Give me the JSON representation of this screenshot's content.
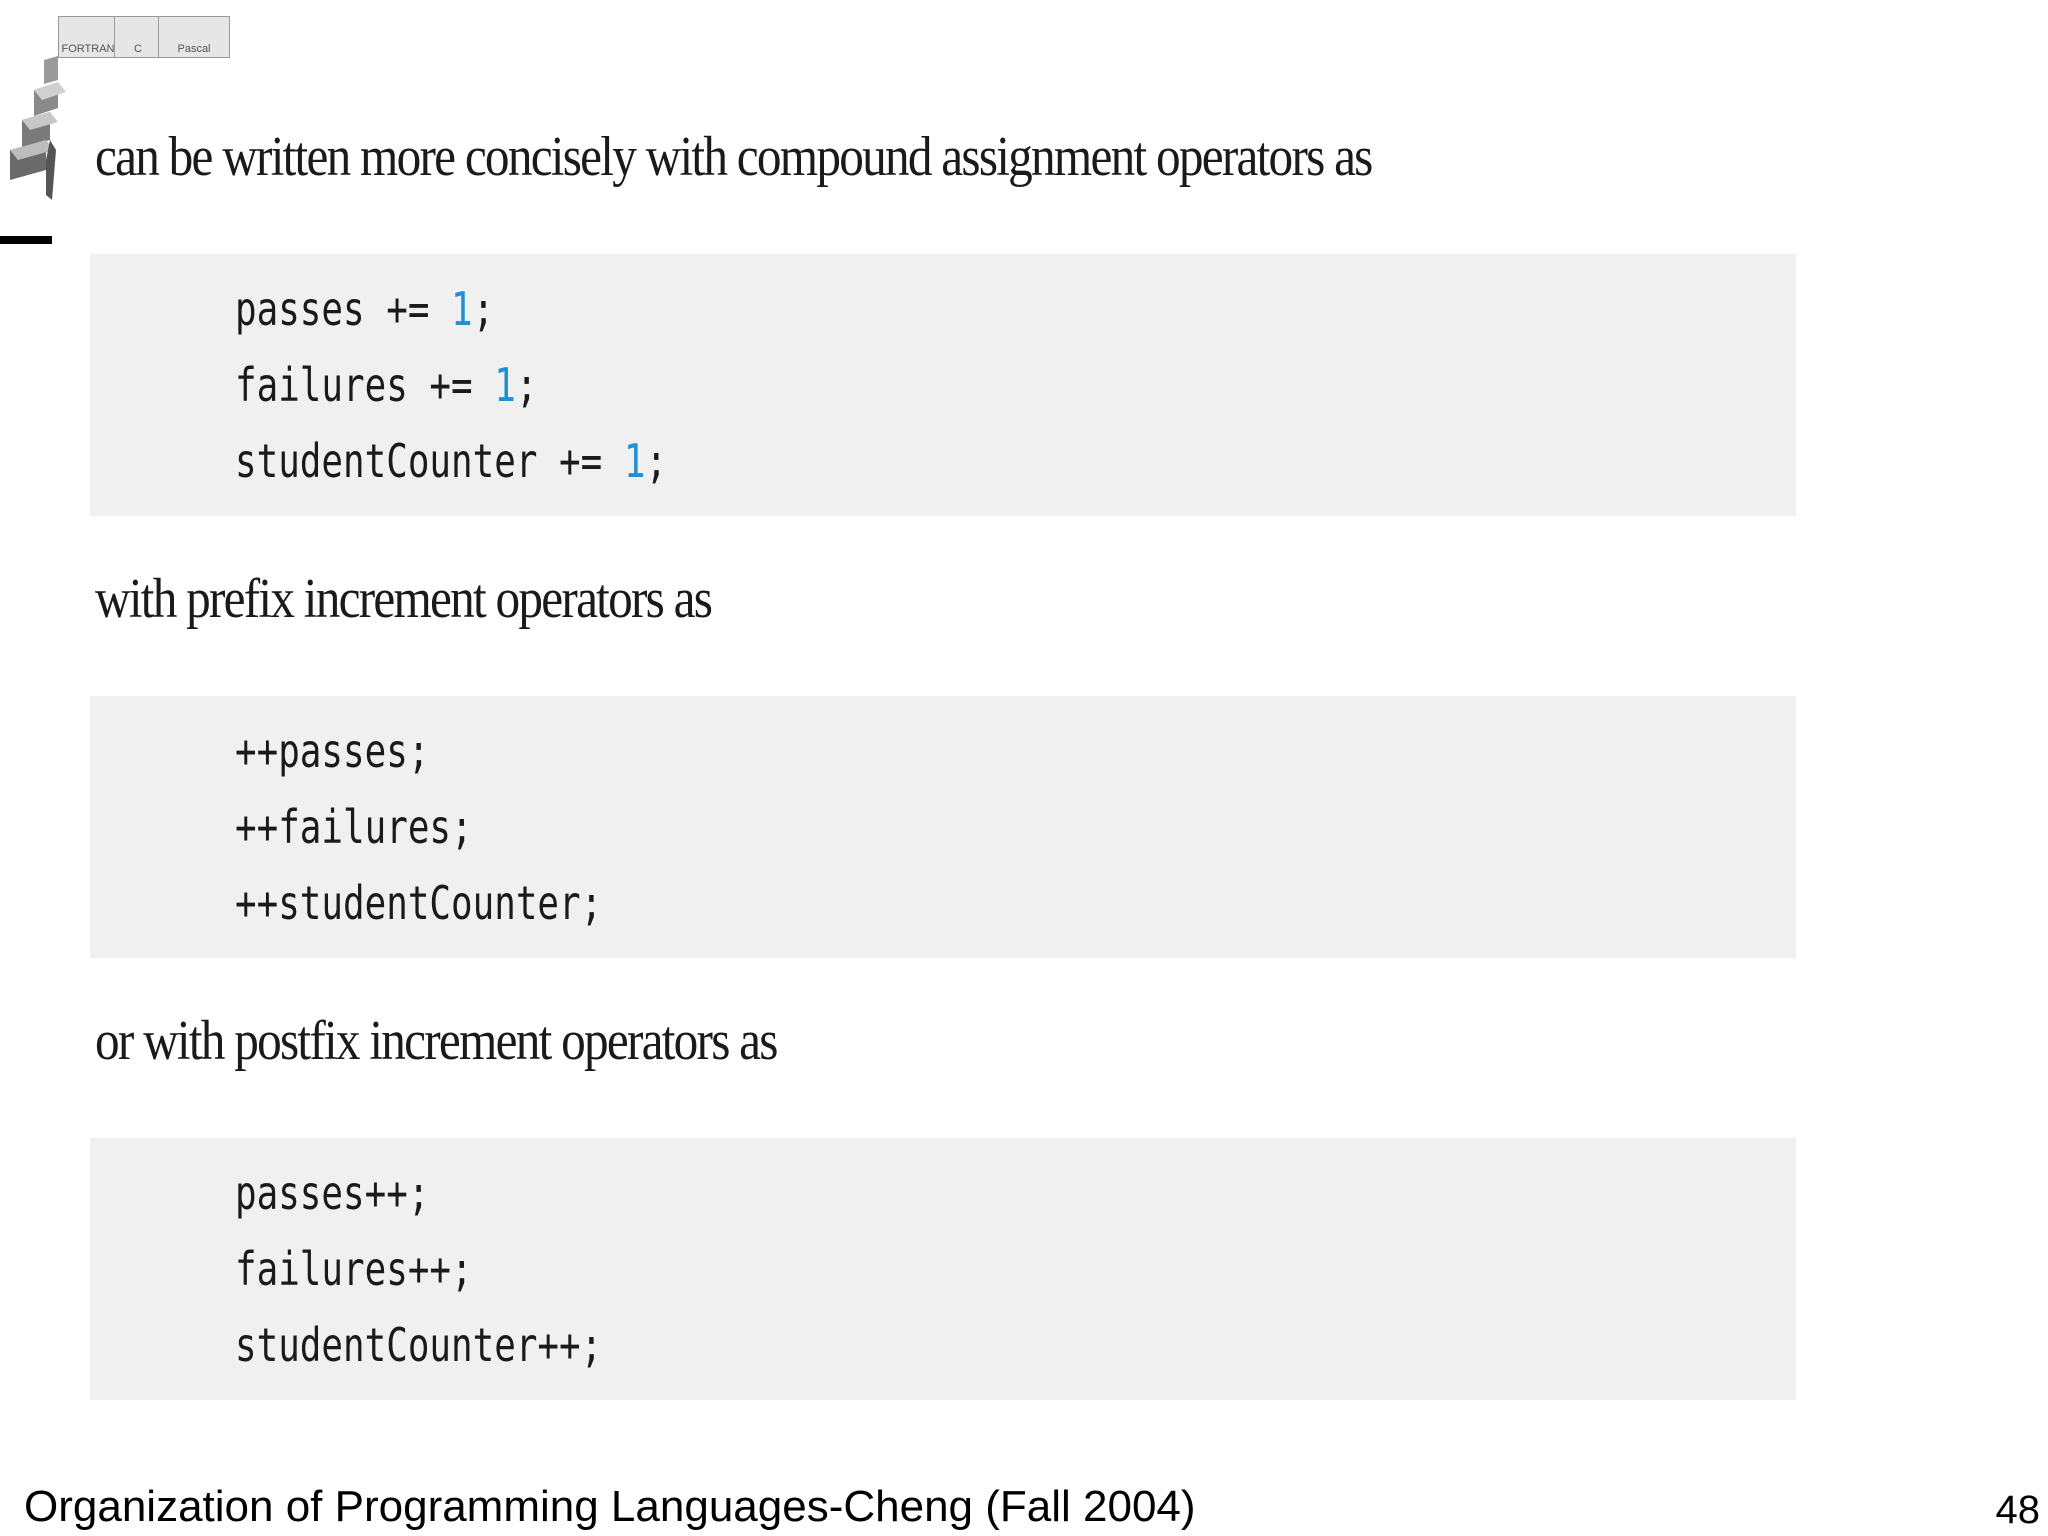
{
  "logo": {
    "tabs": [
      "FORTRAN",
      "C",
      "Pascal"
    ]
  },
  "sections": [
    {
      "intro": "can be written more concisely with compound assignment operators as",
      "lines": [
        {
          "pre": "passes += ",
          "num": "1",
          "post": ";"
        },
        {
          "pre": "failures += ",
          "num": "1",
          "post": ";"
        },
        {
          "pre": "studentCounter += ",
          "num": "1",
          "post": ";"
        }
      ]
    },
    {
      "intro": "with prefix increment operators as",
      "lines": [
        {
          "pre": "++passes;",
          "num": "",
          "post": ""
        },
        {
          "pre": "++failures;",
          "num": "",
          "post": ""
        },
        {
          "pre": "++studentCounter;",
          "num": "",
          "post": ""
        }
      ]
    },
    {
      "intro": "or with postfix increment operators as",
      "lines": [
        {
          "pre": "passes++;",
          "num": "",
          "post": ""
        },
        {
          "pre": "failures++;",
          "num": "",
          "post": ""
        },
        {
          "pre": "studentCounter++;",
          "num": "",
          "post": ""
        }
      ]
    }
  ],
  "footer": {
    "course": "Organization of Programming Languages-Cheng (Fall 2004)",
    "page": "48"
  },
  "colors": {
    "number_literal": "#1e90d6",
    "code_background": "#f0f0f0"
  }
}
